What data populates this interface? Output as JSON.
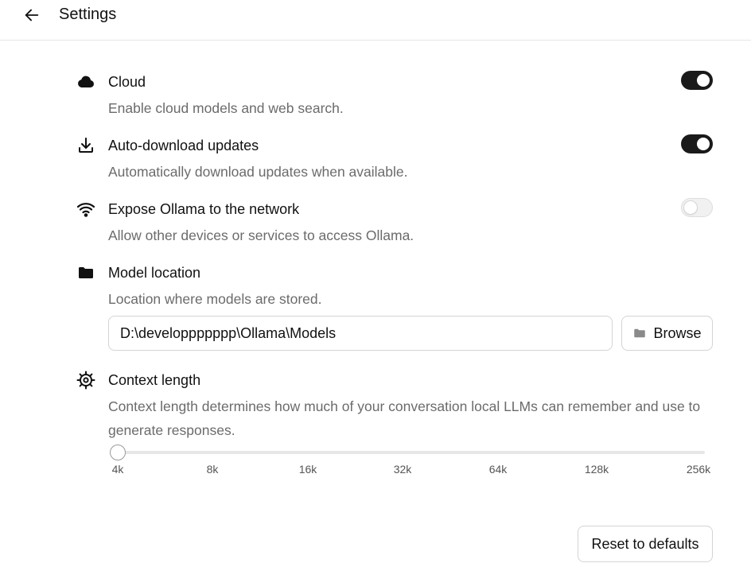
{
  "header": {
    "title": "Settings",
    "back_icon": "arrow-left-icon"
  },
  "settings": {
    "cloud": {
      "icon": "cloud-icon",
      "title": "Cloud",
      "description": "Enable cloud models and web search.",
      "toggle": "on"
    },
    "auto_download": {
      "icon": "download-icon",
      "title": "Auto-download updates",
      "description": "Automatically download updates when available.",
      "toggle": "on"
    },
    "expose_network": {
      "icon": "wifi-icon",
      "title": "Expose Ollama to the network",
      "description": "Allow other devices or services to access Ollama.",
      "toggle": "off"
    },
    "model_location": {
      "icon": "folder-icon",
      "title": "Model location",
      "description": "Location where models are stored.",
      "path_value": "D:\\developpppppp\\Ollama\\Models",
      "browse_label": "Browse",
      "browse_icon": "folder-icon"
    },
    "context_length": {
      "icon": "cog-icon",
      "title": "Context length",
      "description": "Context length determines how much of your conversation local LLMs can remember and use to generate responses.",
      "ticks": [
        "4k",
        "8k",
        "16k",
        "32k",
        "64k",
        "128k",
        "256k"
      ],
      "selected": "4k"
    }
  },
  "footer": {
    "reset_label": "Reset to defaults"
  },
  "colors": {
    "toggle_on": "#1a1a1a",
    "toggle_off": "#f1f1f1",
    "description_text": "#6b6b6b",
    "border": "#d4d4d4"
  }
}
